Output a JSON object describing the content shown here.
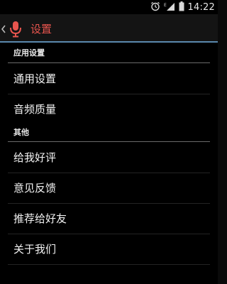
{
  "status_bar": {
    "time": "14:22"
  },
  "action_bar": {
    "title": "设置",
    "back_icon": "chevron-left",
    "app_icon": "microphone",
    "accent_color": "#e8554e",
    "underline_color": "#5a88ad"
  },
  "sections": [
    {
      "header": "应用设置",
      "items": [
        {
          "label": "通用设置"
        },
        {
          "label": "音频质量"
        }
      ]
    },
    {
      "header": "其他",
      "items": [
        {
          "label": "给我好评"
        },
        {
          "label": "意见反馈"
        },
        {
          "label": "推荐给好友"
        },
        {
          "label": "关于我们"
        }
      ]
    }
  ]
}
